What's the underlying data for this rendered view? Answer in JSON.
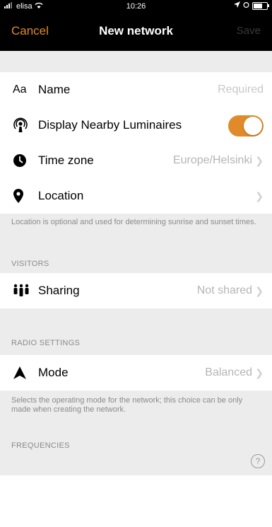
{
  "status_bar": {
    "carrier": "elisa",
    "time": "10:26"
  },
  "nav": {
    "cancel": "Cancel",
    "title": "New network",
    "save": "Save"
  },
  "rows": {
    "name": {
      "icon_text": "Aa",
      "label": "Name",
      "value": "Required"
    },
    "nearby": {
      "label": "Display Nearby Luminaires",
      "toggle_on": true
    },
    "timezone": {
      "label": "Time zone",
      "value": "Europe/Helsinki"
    },
    "location": {
      "label": "Location"
    },
    "sharing": {
      "label": "Sharing",
      "value": "Not shared"
    },
    "mode": {
      "label": "Mode",
      "value": "Balanced"
    }
  },
  "notes": {
    "location": "Location is optional and used for determining sunrise and sunset times.",
    "mode": "Selects the operating mode for the network; this choice can be only made when creating the network."
  },
  "sections": {
    "visitors": "VISITORS",
    "radio": "RADIO SETTINGS",
    "frequencies": "FREQUENCIES"
  },
  "help_label": "?",
  "colors": {
    "accent": "#e08a2a"
  }
}
